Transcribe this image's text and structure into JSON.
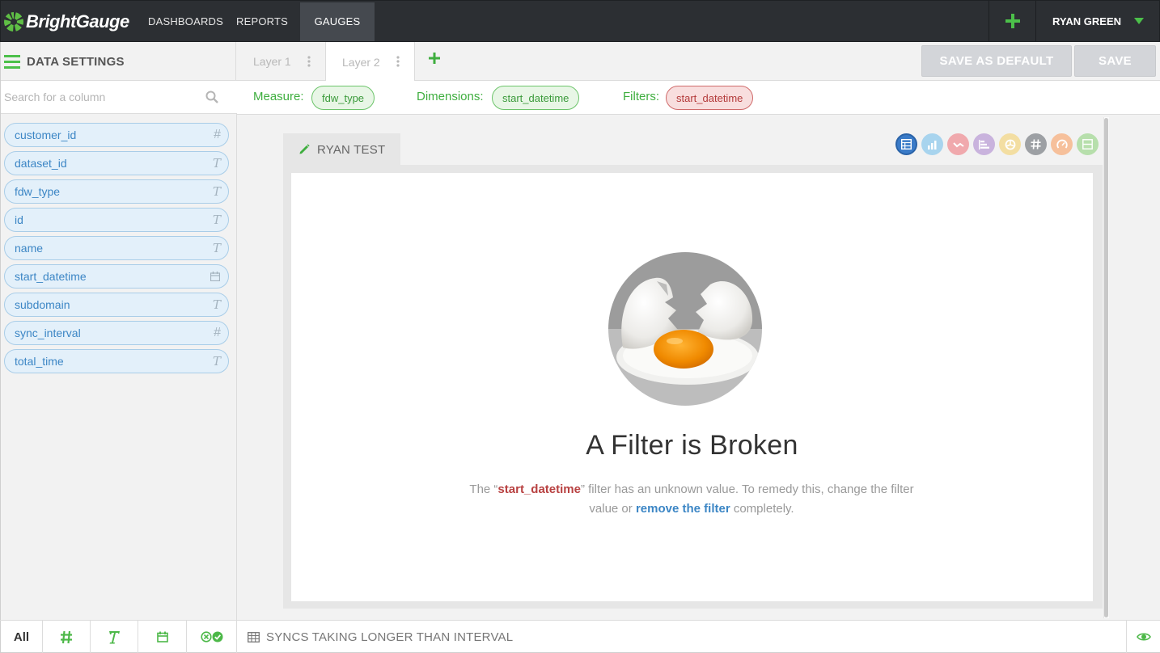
{
  "app": {
    "brand": "BrightGauge"
  },
  "nav": {
    "items": [
      {
        "label": "DASHBOARDS"
      },
      {
        "label": "REPORTS"
      },
      {
        "label": "GAUGES"
      }
    ],
    "user": "RYAN GREEN"
  },
  "data_settings": {
    "title": "DATA SETTINGS"
  },
  "layers": [
    {
      "label": "Layer 1"
    },
    {
      "label": "Layer 2"
    }
  ],
  "buttons": {
    "save_default": "SAVE AS DEFAULT",
    "save": "SAVE"
  },
  "search": {
    "placeholder": "Search for a column"
  },
  "columns": [
    {
      "name": "customer_id",
      "type": "#"
    },
    {
      "name": "dataset_id",
      "type": "T"
    },
    {
      "name": "fdw_type",
      "type": "T"
    },
    {
      "name": "id",
      "type": "T"
    },
    {
      "name": "name",
      "type": "T"
    },
    {
      "name": "start_datetime",
      "type": "date"
    },
    {
      "name": "subdomain",
      "type": "T"
    },
    {
      "name": "sync_interval",
      "type": "#"
    },
    {
      "name": "total_time",
      "type": "T"
    }
  ],
  "filters": {
    "measure_label": "Measure:",
    "measure_value": "fdw_type",
    "dimensions_label": "Dimensions:",
    "dimensions_value": "start_datetime",
    "filters_label": "Filters:",
    "filters_value": "start_datetime"
  },
  "gauge": {
    "name": "RYAN TEST",
    "types": [
      {
        "icon": "table-icon",
        "color": "#3a7bc8",
        "active": true
      },
      {
        "icon": "bar-chart-icon",
        "color": "#a8d4ee"
      },
      {
        "icon": "line-chart-icon",
        "color": "#f0a9ad"
      },
      {
        "icon": "horizontal-bar-icon",
        "color": "#c9b3dd"
      },
      {
        "icon": "pie-icon",
        "color": "#f3dea2"
      },
      {
        "icon": "number-icon",
        "color": "#9da0a4"
      },
      {
        "icon": "speedometer-icon",
        "color": "#f6c09b"
      },
      {
        "icon": "list-icon",
        "color": "#b7dfac"
      }
    ]
  },
  "error": {
    "title": "A Filter is Broken",
    "msg_prefix": "The “",
    "msg_field": "start_datetime",
    "msg_middle": "” filter has an unknown value. To remedy this, change the filter value or ",
    "msg_link": "remove the filter",
    "msg_suffix": " completely."
  },
  "bottom": {
    "all_label": "All",
    "status": "SYNCS TAKING LONGER THAN INTERVAL"
  },
  "colors": {
    "brand_green": "#3fae3f",
    "link_blue": "#3c86c5",
    "error_red": "#b84141",
    "nav_dark": "#2c2f33"
  }
}
